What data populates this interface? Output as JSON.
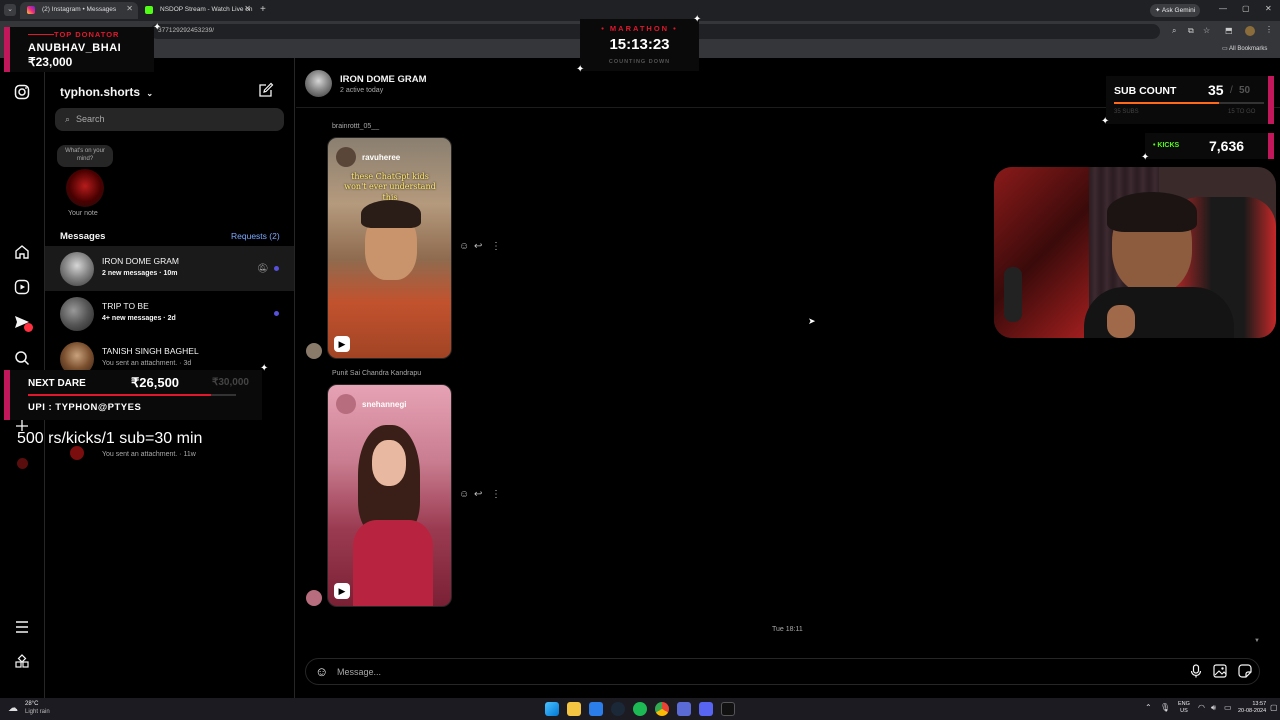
{
  "browser": {
    "tabs": [
      {
        "label": "(2) Instagram • Messages",
        "active": true
      },
      {
        "label": "NSDOP Stream - Watch Live on",
        "active": false
      }
    ],
    "url_fragment": "377129292453239/",
    "ask_gemini": "Ask Gemini",
    "all_bookmarks": "All Bookmarks"
  },
  "sidebar": {
    "username": "typhon.shorts",
    "search_placeholder": "Search",
    "note_bubble": "What's on your mind?",
    "your_note": "Your note",
    "messages_heading": "Messages",
    "requests_label": "Requests (2)",
    "threads": [
      {
        "name": "IRON DOME GRAM",
        "sub": "2 new messages · 10m"
      },
      {
        "name": "TRIP TO BE",
        "sub": "4+ new messages · 2d"
      },
      {
        "name": "TANISH SINGH BAGHEL",
        "sub": "You sent an attachment. · 3d"
      },
      {
        "name": "",
        "sub": "You sent an attachment. · 11w"
      }
    ]
  },
  "chat": {
    "title": "IRON DOME GRAM",
    "subtitle": "2 active today",
    "messages": [
      {
        "sender": "brainrottt_05__",
        "reel_user": "ravuheree",
        "caption": "these ChatGpt kids won't ever understand this"
      },
      {
        "sender": "Punit Sai Chandra Kandrapu",
        "reel_user": "snehannegi",
        "caption": ""
      }
    ],
    "timestamp": "Tue 18:11",
    "composer_placeholder": "Message..."
  },
  "overlays": {
    "top_donator_label": "TOP DONATOR",
    "top_donator_name": "ANUBHAV_BHAI",
    "top_donator_amount": "₹23,000",
    "marathon_label": "MARATHON",
    "marathon_time": "15:13:23",
    "marathon_sub": "COUNTING DOWN",
    "sub_count_label": "SUB COUNT",
    "sub_count_value": "35",
    "sub_count_goal": "50",
    "sub_count_small_left": "35 SUBS",
    "sub_count_small_right": "15 TO GO",
    "kicks_label": "• KICKS",
    "kicks_value": "7,636",
    "next_dare_label": "NEXT DARE",
    "next_dare_amount": "₹26,500",
    "next_dare_goal": "₹30,000",
    "upi": "UPI : TYPHON@PTYES",
    "rate_text": "500 rs/kicks/1 sub=30 min"
  },
  "taskbar": {
    "weather_temp": "28°C",
    "weather_desc": "Light rain",
    "lang_top": "ENG",
    "lang_bottom": "US",
    "time": "13:57",
    "date": "20-08-2024"
  },
  "colors": {
    "accent_blue": "#0095f6",
    "requests_blue": "#7aa8ff",
    "unread_dot": "#5851db",
    "kicks_green": "#53fc18",
    "donator_red": "#e0182d"
  }
}
